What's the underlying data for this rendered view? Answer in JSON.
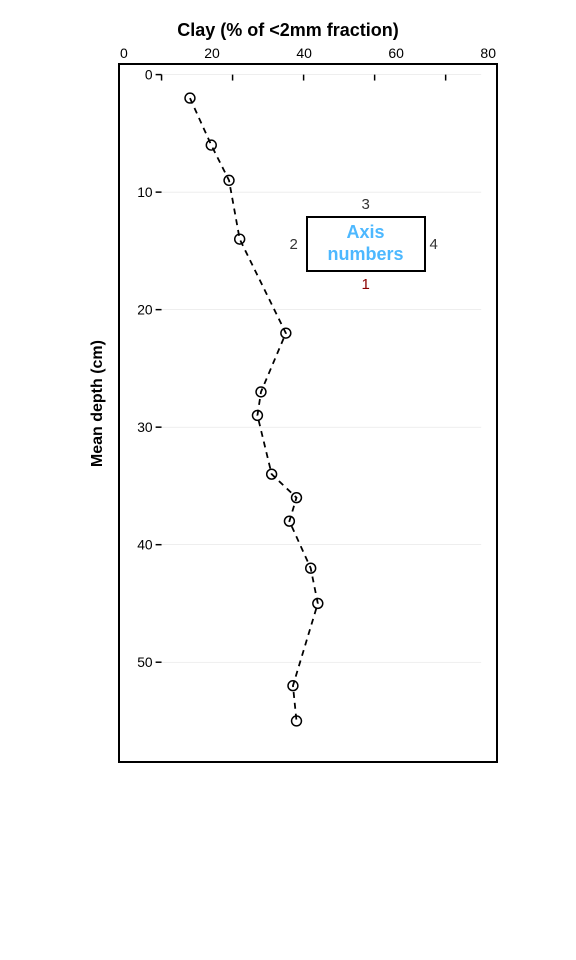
{
  "chart": {
    "x_title": "Clay (% of <2mm fraction)",
    "x_axis_ticks": [
      "0",
      "20",
      "40",
      "60",
      "80"
    ],
    "y_title": "Mean depth (cm)",
    "y_axis_ticks": [
      "0",
      "10",
      "20",
      "30",
      "40",
      "50"
    ],
    "annotation_label": "Axis\nnumbers",
    "annotation_numbers": {
      "top": "3",
      "left": "2",
      "bottom": "1",
      "right": "4"
    },
    "data_points": [
      {
        "clay": 8,
        "depth": 2
      },
      {
        "clay": 14,
        "depth": 6
      },
      {
        "clay": 19,
        "depth": 9
      },
      {
        "clay": 22,
        "depth": 14
      },
      {
        "clay": 35,
        "depth": 22
      },
      {
        "clay": 28,
        "depth": 27
      },
      {
        "clay": 27,
        "depth": 29
      },
      {
        "clay": 31,
        "depth": 34
      },
      {
        "clay": 38,
        "depth": 36
      },
      {
        "clay": 36,
        "depth": 38
      },
      {
        "clay": 42,
        "depth": 42
      },
      {
        "clay": 44,
        "depth": 45
      },
      {
        "clay": 37,
        "depth": 52
      },
      {
        "clay": 38,
        "depth": 55
      }
    ],
    "x_min": 0,
    "x_max": 90,
    "y_min": 0,
    "y_max": 57
  }
}
